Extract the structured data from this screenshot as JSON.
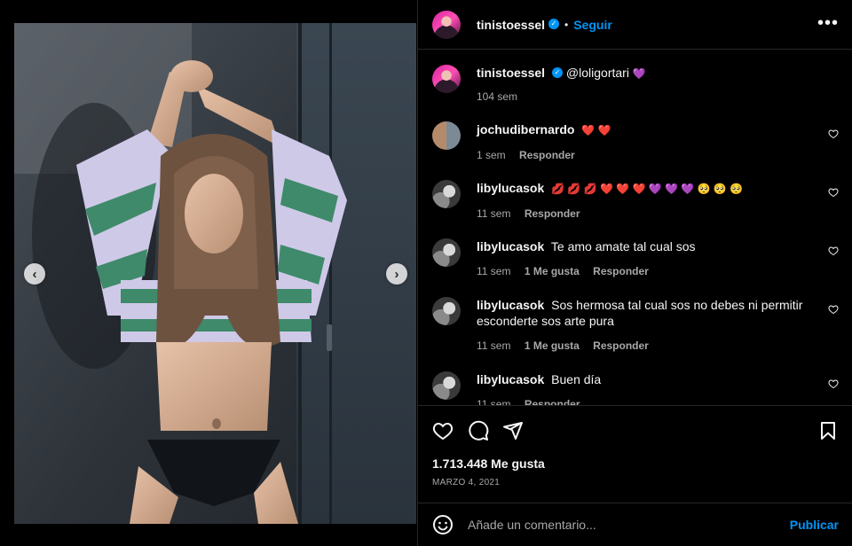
{
  "carousel": {
    "prev_icon": "chevron-left-icon",
    "next_icon": "chevron-right-icon",
    "prev_glyph": "‹",
    "next_glyph": "›",
    "dot_count": 4,
    "active_dot": 3
  },
  "header": {
    "username": "tinistoessel",
    "separator": "•",
    "follow_label": "Seguir",
    "more_glyph": "•••"
  },
  "caption": {
    "username": "tinistoessel",
    "text": "@loligortari",
    "emoji": "💜",
    "time": "104 sem"
  },
  "comments": [
    {
      "username": "jochudibernardo",
      "text": "",
      "emoji": "❤️ ❤️",
      "time": "1 sem",
      "likes": "",
      "reply": "Responder"
    },
    {
      "username": "libylucasok",
      "text": "",
      "emoji": "💋 💋 💋 ❤️ ❤️ ❤️ 💜 💜 💜 🥺 🥺 🥺",
      "time": "11 sem",
      "likes": "",
      "reply": "Responder"
    },
    {
      "username": "libylucasok",
      "text": "Te amo amate tal cual sos",
      "emoji": "",
      "time": "11 sem",
      "likes": "1 Me gusta",
      "reply": "Responder"
    },
    {
      "username": "libylucasok",
      "text": "Sos hermosa tal cual sos no debes ni permitir esconderte sos arte pura",
      "emoji": "",
      "time": "11 sem",
      "likes": "1 Me gusta",
      "reply": "Responder"
    },
    {
      "username": "libylucasok",
      "text": "Buen día",
      "emoji": "",
      "time": "11 sem",
      "likes": "",
      "reply": "Responder"
    }
  ],
  "actions": {
    "like_icon": "heart-icon",
    "comment_icon": "comment-icon",
    "share_icon": "share-icon",
    "save_icon": "bookmark-icon"
  },
  "post": {
    "likes": "1.713.448 Me gusta",
    "date": "MARZO 4, 2021"
  },
  "comment_bar": {
    "placeholder": "Añade un comentario...",
    "publish_label": "Publicar",
    "emoji_icon": "smiley-icon"
  },
  "colors": {
    "background": "#000000",
    "accent": "#0095f6",
    "text": "#f5f5f5",
    "muted": "#a8a8a8",
    "divider": "#262626"
  }
}
